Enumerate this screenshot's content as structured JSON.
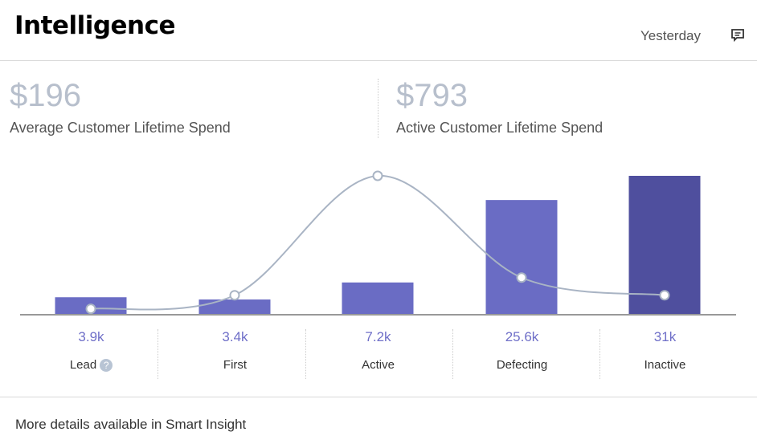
{
  "header": {
    "title": "Intelligence",
    "period": "Yesterday",
    "comment_icon": "comment-icon"
  },
  "kpis": [
    {
      "value": "$196",
      "label": "Average Customer Lifetime Spend"
    },
    {
      "value": "$793",
      "label": "Active Customer Lifetime Spend"
    }
  ],
  "chart_data": {
    "type": "bar",
    "categories": [
      "Lead",
      "First",
      "Active",
      "Defecting",
      "Inactive"
    ],
    "values": [
      3.9,
      3.4,
      7.2,
      25.6,
      31
    ],
    "value_labels": [
      "3.9k",
      "3.4k",
      "7.2k",
      "25.6k",
      "31k"
    ],
    "bar_colors": [
      "#6a6cc4",
      "#6a6cc4",
      "#6a6cc4",
      "#6a6cc4",
      "#4f4f9e"
    ],
    "line_relative": [
      0.02,
      0.12,
      1.0,
      0.25,
      0.12
    ],
    "line_color": "#a9b4c4",
    "help_icon": "question-icon"
  },
  "footer": {
    "text": "More details available in Smart Insight"
  }
}
